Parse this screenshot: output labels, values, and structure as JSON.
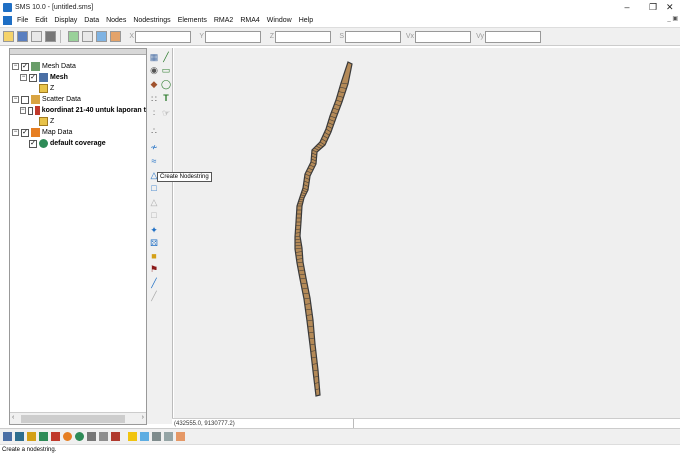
{
  "window": {
    "title": "SMS 10.0 - [untitled.sms]"
  },
  "menu": [
    "File",
    "Edit",
    "Display",
    "Data",
    "Nodes",
    "Nodestrings",
    "Elements",
    "RMA2",
    "RMA4",
    "Window",
    "Help"
  ],
  "coords": {
    "labels": [
      "X",
      "Y",
      "Z",
      "S",
      "Vx",
      "Vy"
    ]
  },
  "tree": {
    "mesh_data": "Mesh Data",
    "mesh": "Mesh",
    "mesh_z": "Z",
    "scatter_data": "Scatter Data",
    "scatter_set": "koordinat 21-40 untuk laporan t",
    "scatter_z": "Z",
    "map_data": "Map Data",
    "coverage": "default coverage"
  },
  "tooltip": "Create Nodestring",
  "coord_readout": "(432555.0, 9130777.2)",
  "status": "Create a nodestring.",
  "colors": {
    "mesh_outline": "#3a3a3a",
    "mesh_fill": "#b48a58",
    "canvas": "#efefef"
  },
  "icons": {
    "tree": [
      "mesh-data-icon",
      "mesh-icon",
      "z-dataset-icon",
      "scatter-data-icon",
      "scatter-set-icon",
      "map-data-icon",
      "coverage-icon"
    ],
    "tools": [
      "select-element-icon",
      "create-nodestring-icon"
    ]
  }
}
